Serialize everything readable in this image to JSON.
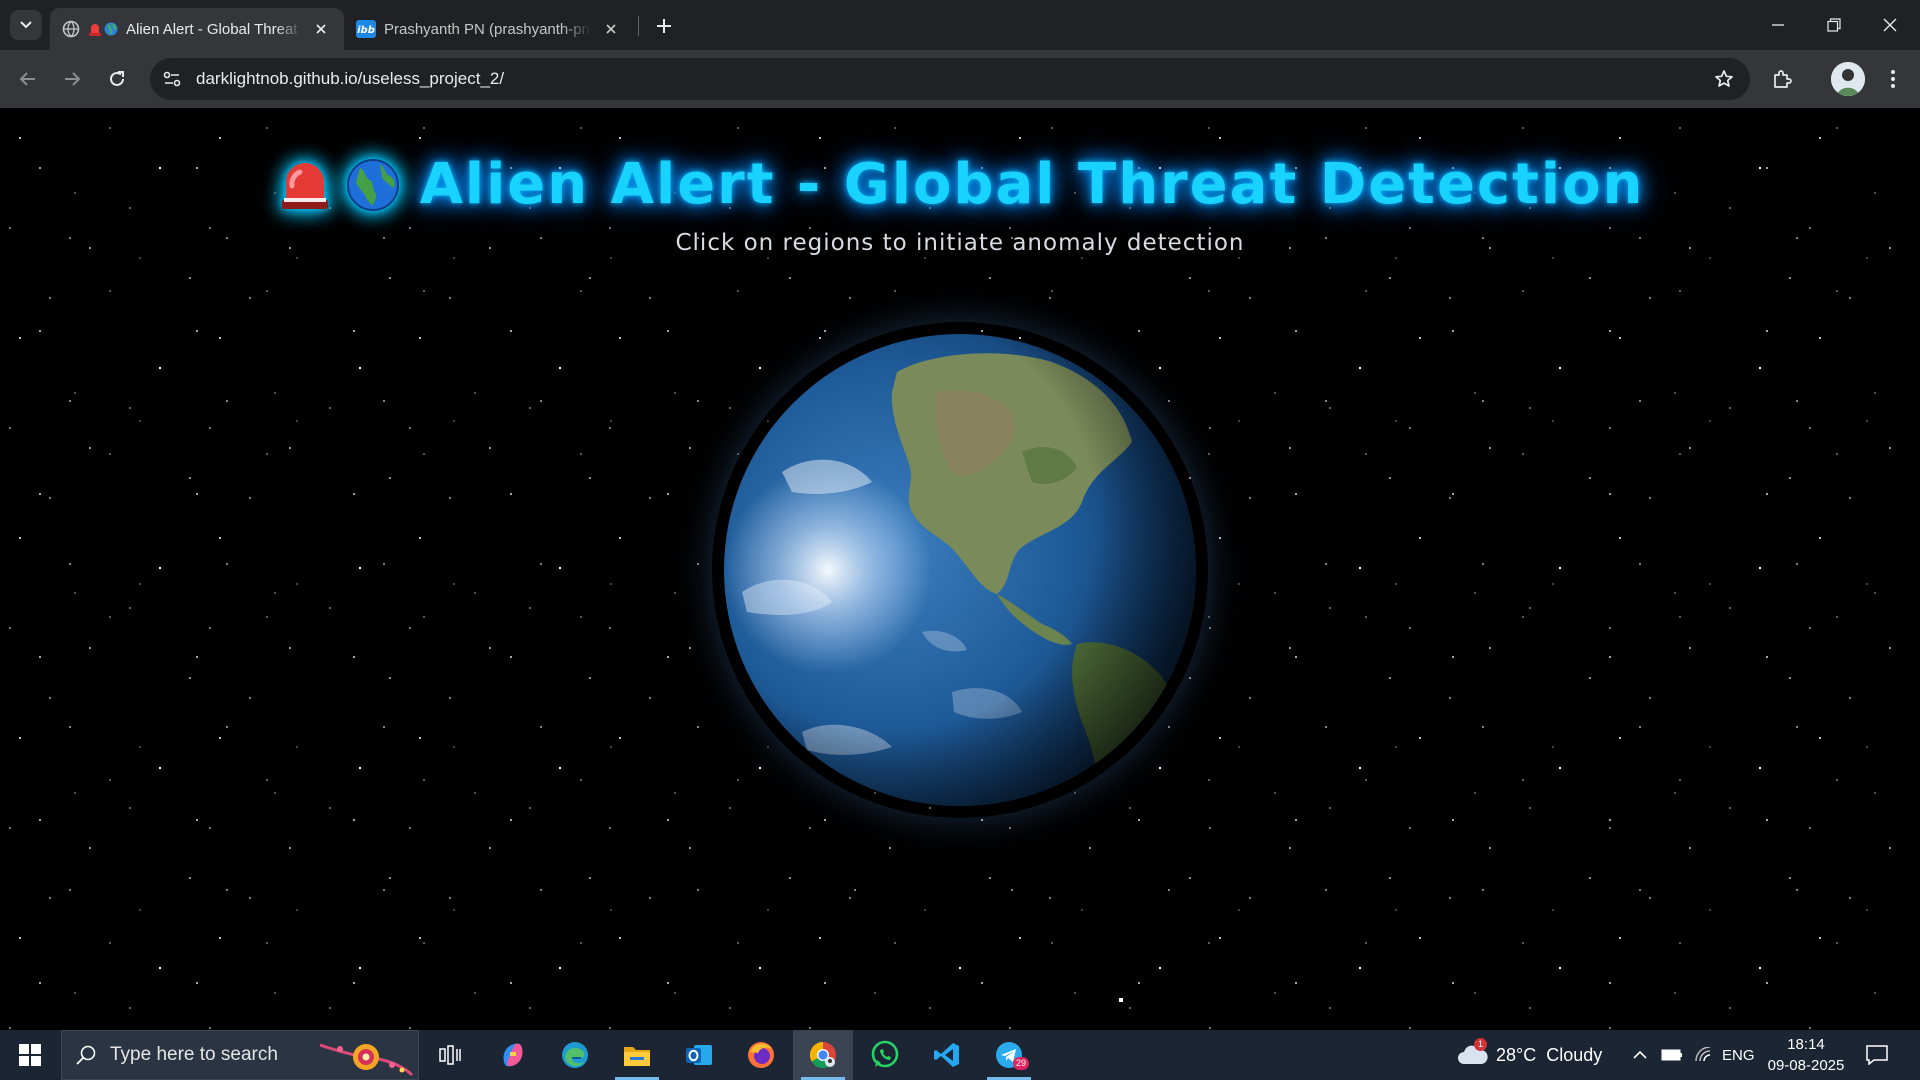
{
  "browser": {
    "tabs": [
      {
        "title": "Alien Alert - Global Threat Detection",
        "active": true
      },
      {
        "title": "Prashyanth PN (prashyanth-pn)",
        "active": false
      }
    ],
    "address": {
      "url": "darklightnob.github.io/useless_project_2/"
    }
  },
  "page": {
    "title_emojis": [
      "🚨",
      "🌍"
    ],
    "title": "Alien Alert - Global Threat Detection",
    "subtitle": "Click on regions to initiate anomaly detection",
    "title_color": "#18d2ff"
  },
  "taskbar": {
    "search_placeholder": "Type here to search",
    "apps": [
      "task-view",
      "copilot",
      "edge",
      "file-explorer",
      "outlook",
      "firefox",
      "chrome",
      "whatsapp",
      "vscode",
      "telegram"
    ],
    "telegram_badge": "29",
    "weather": {
      "badge": "1",
      "text": "28°C  Cloudy"
    },
    "language": "ENG",
    "time": "18:14",
    "date": "09-08-2025"
  }
}
